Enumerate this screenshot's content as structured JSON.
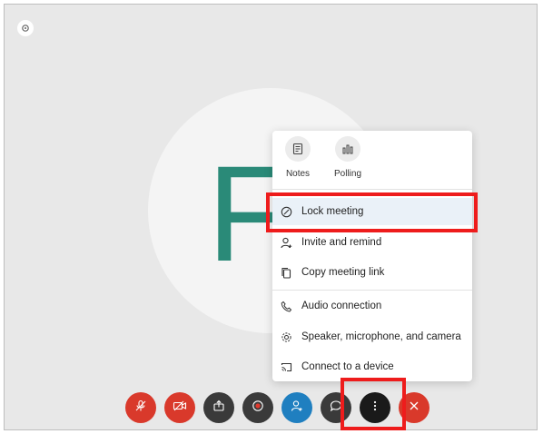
{
  "meeting": {
    "avatar_initial": "F",
    "colors": {
      "stage_bg": "#e8e8e8",
      "avatar_letter": "#2a8a78",
      "red_button": "#d9392b",
      "highlight_annotation": "#ee1c1c"
    }
  },
  "more_menu": {
    "quick_actions": [
      {
        "label": "Notes",
        "icon": "notes-icon"
      },
      {
        "label": "Polling",
        "icon": "polling-icon"
      }
    ],
    "items": [
      {
        "label": "Lock meeting",
        "icon": "lock-icon",
        "highlighted": true
      },
      {
        "label": "Invite and remind",
        "icon": "invite-person-icon"
      },
      {
        "label": "Copy meeting link",
        "icon": "copy-icon"
      },
      {
        "label": "Audio connection",
        "icon": "phone-icon"
      },
      {
        "label": "Speaker, microphone, and camera",
        "icon": "gear-icon"
      },
      {
        "label": "Connect to a device",
        "icon": "cast-icon"
      }
    ]
  },
  "toolbar": {
    "buttons": [
      {
        "name": "mute-button",
        "icon": "microphone-muted-icon"
      },
      {
        "name": "video-button",
        "icon": "video-off-icon"
      },
      {
        "name": "share-button",
        "icon": "share-icon"
      },
      {
        "name": "record-button",
        "icon": "record-icon"
      },
      {
        "name": "participants-button",
        "icon": "participants-icon"
      },
      {
        "name": "chat-button",
        "icon": "chat-icon"
      },
      {
        "name": "more-options-button",
        "icon": "more-dots-icon"
      },
      {
        "name": "leave-button",
        "icon": "close-icon"
      }
    ]
  }
}
